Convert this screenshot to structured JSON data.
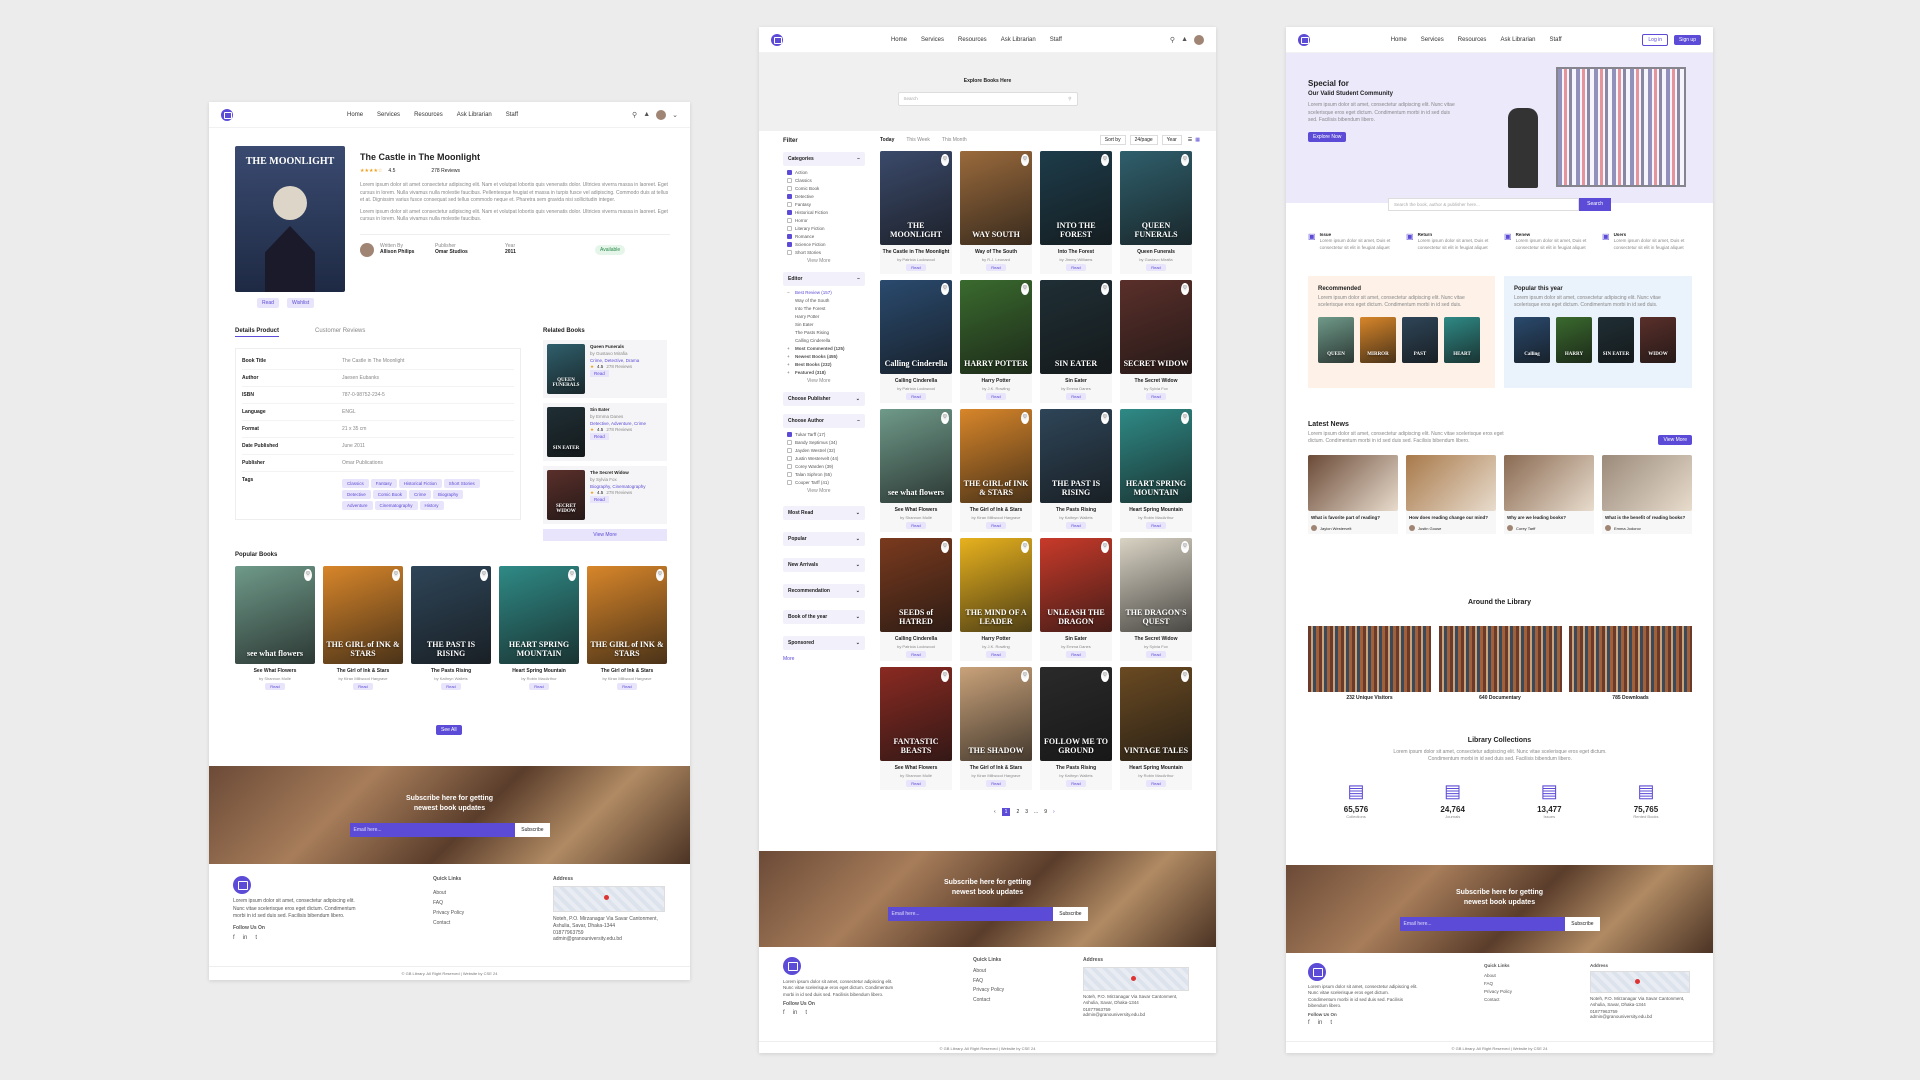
{
  "nav": {
    "links": [
      "Home",
      "Services",
      "Resources",
      "Ask Librarian",
      "Staff"
    ],
    "login": "Log in",
    "signup": "Sign up"
  },
  "detail": {
    "book_title": "The Castle in The Moonlight",
    "cover_title": "THE MOONLIGHT",
    "rating": "4.5",
    "reviews": "278 Reviews",
    "desc1": "Lorem ipsum dolor sit amet consectetur adipiscing elit. Nam et volutpat lobortis quis venenatis dolor. Ultricies viverra massa in laoreet. Eget cursus in lorem. Nulla vivamus nulla molestie faucibus. Pellentesque feugiat et massa in turpis fusce vel adipiscing. Commodo duis at tellus et at. Dignissim varius fusce consequat sed tellus commodo neque et. Pharetra sem gravida nisi sollicitudin integer.",
    "desc2": "Lorem ipsum dolor sit amet consectetur adipiscing elit. Nam et volutpat lobortis quis venenatis dolor. Ultricies viverra massa in laoreet. Eget cursus in lorem. Nulla vivamus nulla molestie faucibus.",
    "written_by_label": "Written By",
    "author": "Allison Philips",
    "publisher_label": "Publisher",
    "publisher": "Omar Studios",
    "year_label": "Year",
    "year": "2011",
    "status": "Available",
    "read_btn": "Read",
    "wishlist_btn": "Wishlist",
    "tab_active": "Details Product",
    "tab_inactive": "Customer Reviews",
    "details": [
      {
        "k": "Book Title",
        "v": "The Castle in The Moonlight"
      },
      {
        "k": "Author",
        "v": "Jaesen Eubanks"
      },
      {
        "k": "ISBN",
        "v": "787-0-98752-234-5"
      },
      {
        "k": "Language",
        "v": "ENGL"
      },
      {
        "k": "Format",
        "v": "21 x 35 cm"
      },
      {
        "k": "Date Published",
        "v": "June 2011"
      },
      {
        "k": "Publisher",
        "v": "Omar Publications"
      }
    ],
    "tags_label": "Tags",
    "tags": [
      "Classics",
      "Fantasy",
      "Historical Fiction",
      "Short Stories",
      "Detective",
      "Comic Book",
      "Crime",
      "Biography",
      "Adventure",
      "Cinematography",
      "History"
    ],
    "related_title": "Related Books",
    "related": [
      {
        "title": "Queen Funerals",
        "by": "by Gustavo Mirafia",
        "genres": "Crime, Detective, Drama",
        "rating": "4.5",
        "reviews": "278 Reviews",
        "btn": "Read",
        "cover": "QUEEN FUNERALS",
        "color": "#2f5f6c"
      },
      {
        "title": "Sin Eater",
        "by": "by Emma Danes",
        "genres": "Detective, Adventure, Crime",
        "rating": "4.5",
        "reviews": "278 Reviews",
        "btn": "Read",
        "cover": "SIN EATER",
        "color": "#1f2f35"
      },
      {
        "title": "The Secret Widow",
        "by": "by Sylvia Fox",
        "genres": "Biography, Cinematography",
        "rating": "4.5",
        "reviews": "278 Reviews",
        "btn": "Read",
        "cover": "SECRET WIDOW",
        "color": "#5a2f2a"
      }
    ],
    "view_more": "View More",
    "popular_title": "Popular Books",
    "popular": [
      {
        "title": "See What Flowers",
        "by": "by Shannon Mullé",
        "btn": "Read",
        "cover": "see what flowers",
        "color": "#6f9a8a"
      },
      {
        "title": "The Girl of Ink & Stars",
        "by": "by Kiran Millwood Hargrave",
        "btn": "Read",
        "cover": "THE GIRL of INK & STARS",
        "color": "#d8862a"
      },
      {
        "title": "The Pasts Rising",
        "by": "by Kathryn Wallets",
        "btn": "Read",
        "cover": "THE PAST IS RISING",
        "color": "#2e4558"
      },
      {
        "title": "Heart Spring Mountain",
        "by": "by Robin MacArthur",
        "btn": "Read",
        "cover": "HEART SPRING MOUNTAIN",
        "color": "#2f8a86"
      },
      {
        "title": "The Girl of Ink & Stars",
        "by": "by Kiran Millwood Hargrave",
        "btn": "Read",
        "cover": "THE GIRL of INK & STARS",
        "color": "#d8862a"
      }
    ],
    "see_all": "See All"
  },
  "subscribe": {
    "text": "Subscribe here for getting newest book updates",
    "email_placeholder": "Email here...",
    "button": "Subscribe"
  },
  "footer": {
    "about": "Lorem ipsum dolor sit amet, consectetur adipiscing elit. Nunc vitae scelerisque eros eget dictum. Condimentum morbi in id sed duis sed. Facilisis bibendum libero.",
    "follow": "Follow Us On",
    "quick_links_title": "Quick Links",
    "quick_links": [
      "About",
      "FAQ",
      "Privacy Policy",
      "Contact"
    ],
    "address_title": "Address",
    "address": "Noteh, P.O. Mirzanagar Via Savar Cantonment, Ashulia, Savar, Dhaka-1344",
    "phone": "01877963759",
    "email": "admin@granouniversity.edu.bd",
    "copyright": "© GB Library. All Right Reserved | Website by CSE 24"
  },
  "browse": {
    "hero_title": "Explore Books Here",
    "search_placeholder": "Search",
    "filter_title": "Filter",
    "time_tabs": [
      "Today",
      "This Week",
      "This Month"
    ],
    "sort_label": "Sort by",
    "view_label": "24/page",
    "rows_label": "Year",
    "categories_title": "Categories",
    "categories": [
      {
        "label": "Action",
        "on": true
      },
      {
        "label": "Classics",
        "on": false
      },
      {
        "label": "Comic Book",
        "on": false
      },
      {
        "label": "Detective",
        "on": true
      },
      {
        "label": "Fantasy",
        "on": false
      },
      {
        "label": "Historical Fiction",
        "on": true
      },
      {
        "label": "Horror",
        "on": false
      },
      {
        "label": "Literary Fiction",
        "on": false
      },
      {
        "label": "Romance",
        "on": true
      },
      {
        "label": "Science Fiction",
        "on": true
      },
      {
        "label": "Short Stories",
        "on": false
      }
    ],
    "editor_title": "Editor",
    "editor_items": [
      "Best Review (157)",
      "Way of the South",
      "Into The Forest",
      "Harry Potter",
      "Sin Eater",
      "The Pasts Rising",
      "Calling Cinderella",
      "Most Commented (125)",
      "Newest Books (455)",
      "Best Books (232)",
      "Featured (318)"
    ],
    "view_more": "View More",
    "publisher_title": "Choose Publisher",
    "author_title": "Choose Author",
    "authors": [
      {
        "label": "Tukar Tarff (17)",
        "on": true
      },
      {
        "label": "Bandy Septimus (34)",
        "on": false
      },
      {
        "label": "Jayden Westrel (32)",
        "on": false
      },
      {
        "label": "Justin Westervelt (44)",
        "on": false
      },
      {
        "label": "Corey Warden (39)",
        "on": false
      },
      {
        "label": "Talan Siphron (55)",
        "on": false
      },
      {
        "label": "Cooper Tarff (41)",
        "on": false
      }
    ],
    "more_sections": [
      "Most Read",
      "Popular",
      "New Arrivals",
      "Recommendation",
      "Book of the year",
      "Sponsored"
    ],
    "more": "More",
    "books": [
      {
        "title": "The Castle in The Moonlight",
        "by": "by Patricia Lockwood",
        "cover": "THE MOONLIGHT",
        "color": "#3b4a6b"
      },
      {
        "title": "Way of The South",
        "by": "by R.J. Leonard",
        "cover": "WAY SOUTH",
        "color": "#9a6a3c"
      },
      {
        "title": "Into The Forest",
        "by": "by Jimmy Williams",
        "cover": "INTO THE FOREST",
        "color": "#1d3c4a"
      },
      {
        "title": "Queen Funerals",
        "by": "by Gustavo Mirafia",
        "cover": "QUEEN FUNERALS",
        "color": "#2f5f6c"
      },
      {
        "title": "Calling Cinderella",
        "by": "by Patricia Lockwood",
        "cover": "Calling Cinderella",
        "color": "#2a4a6e"
      },
      {
        "title": "Harry Potter",
        "by": "by J.K. Rowling",
        "cover": "HARRY POTTER",
        "color": "#3a6a2e"
      },
      {
        "title": "Sin Eater",
        "by": "by Emma Danes",
        "cover": "SIN EATER",
        "color": "#1f2f35"
      },
      {
        "title": "The Secret Widow",
        "by": "by Sylvia Fox",
        "cover": "SECRET WIDOW",
        "color": "#5a2f2a"
      },
      {
        "title": "See What Flowers",
        "by": "by Shannon Mullé",
        "cover": "see what flowers",
        "color": "#6f9a8a"
      },
      {
        "title": "The Girl of Ink & Stars",
        "by": "by Kiran Millwood Hargrave",
        "cover": "THE GIRL of INK & STARS",
        "color": "#d8862a"
      },
      {
        "title": "The Pasts Rising",
        "by": "by Kathryn Wallets",
        "cover": "THE PAST IS RISING",
        "color": "#2e4558"
      },
      {
        "title": "Heart Spring Mountain",
        "by": "by Robin MacArthur",
        "cover": "HEART SPRING MOUNTAIN",
        "color": "#2f8a86"
      },
      {
        "title": "Calling Cinderella",
        "by": "by Patricia Lockwood",
        "cover": "SEEDS of HATRED",
        "color": "#7a3a1e"
      },
      {
        "title": "Harry Potter",
        "by": "by J.K. Rowling",
        "cover": "THE MIND OF A LEADER",
        "color": "#e8b21e"
      },
      {
        "title": "Sin Eater",
        "by": "by Emma Danes",
        "cover": "UNLEASH THE DRAGON",
        "color": "#c83a2a"
      },
      {
        "title": "The Secret Widow",
        "by": "by Sylvia Fox",
        "cover": "THE DRAGON'S QUEST",
        "color": "#d9d3c4"
      },
      {
        "title": "See What Flowers",
        "by": "by Shannon Mullé",
        "cover": "FANTASTIC BEASTS",
        "color": "#8a2a22"
      },
      {
        "title": "The Girl of Ink & Stars",
        "by": "by Kiran Millwood Hargrave",
        "cover": "THE SHADOW",
        "color": "#c9a27a"
      },
      {
        "title": "The Pasts Rising",
        "by": "by Kathryn Wallets",
        "cover": "FOLLOW ME TO GROUND",
        "color": "#2a2a2a"
      },
      {
        "title": "Heart Spring Mountain",
        "by": "by Robin MacArthur",
        "cover": "VINTAGE TALES",
        "color": "#6a4a22"
      }
    ],
    "read_btn": "Read",
    "pages": [
      "1",
      "2",
      "3",
      "...",
      "9"
    ]
  },
  "home": {
    "hero_title": "Special for",
    "hero_sub": "Our Valid Student Community",
    "hero_desc": "Lorem ipsum dolor sit amet, consectetur adipiscing elit. Nunc vitae scelerisque eros eget dictum. Condimentum morbi in id sed duis sed. Facilisis bibendum libero.",
    "explore_btn": "Explore Now",
    "search_placeholder": "Search the book, author & publisher here...",
    "search_btn": "Search",
    "features": [
      {
        "title": "Issue",
        "desc": "Lorem ipsum dolor sit amet, Duis et consectetur sit elit in feugiat aliquet"
      },
      {
        "title": "Return",
        "desc": "Lorem ipsum dolor sit amet, Duis et consectetur sit elit in feugiat aliquet"
      },
      {
        "title": "Renew",
        "desc": "Lorem ipsum dolor sit amet, Duis et consectetur sit elit in feugiat aliquet"
      },
      {
        "title": "Users",
        "desc": "Lorem ipsum dolor sit amet, Duis et consectetur sit elit in feugiat aliquet"
      }
    ],
    "recommended_title": "Recommended",
    "recommended_desc": "Lorem ipsum dolor sit amet, consectetur adipiscing elit. Nunc vitae scelerisque eros eget dictum. Condimentum morbi in id sed duis.",
    "popular_title": "Popular this year",
    "popular_desc": "Lorem ipsum dolor sit amet, consectetur adipiscing elit. Nunc vitae scelerisque eros eget dictum. Condimentum morbi in id sed duis.",
    "recommended_covers": [
      {
        "c": "QUEEN",
        "color": "#6f9a8a"
      },
      {
        "c": "MIRROR",
        "color": "#d8862a"
      },
      {
        "c": "PAST",
        "color": "#2e4558"
      },
      {
        "c": "HEART",
        "color": "#2f8a86"
      }
    ],
    "popular_covers": [
      {
        "c": "Calling",
        "color": "#2a4a6e"
      },
      {
        "c": "HARRY",
        "color": "#3a6a2e"
      },
      {
        "c": "SIN EATER",
        "color": "#1f2f35"
      },
      {
        "c": "WIDOW",
        "color": "#5a2f2a"
      }
    ],
    "news_title": "Latest News",
    "news_desc": "Lorem ipsum dolor sit amet, consectetur adipiscing elit. Nunc vitae scelerisque eros eget dictum. Condimentum morbi in id sed duis sed. Facilisis bibendum libero.",
    "news_btn": "View More",
    "news": [
      {
        "title": "What is favorite part of reading?",
        "author": "Jaylon Westervelt"
      },
      {
        "title": "How does reading change our mind?",
        "author": "Justin Gouse"
      },
      {
        "title": "Why are we leading books?",
        "author": "Corey Tarff"
      },
      {
        "title": "What is the benefit of reading books?",
        "author": "Emma Jodorov"
      }
    ],
    "around_title": "Around the Library",
    "around": [
      "232 Unique Visitors",
      "640 Documentary",
      "785 Downloads"
    ],
    "collections_title": "Library Collections",
    "collections_desc": "Lorem ipsum dolor sit amet, consectetur adipiscing elit. Nunc vitae scelerisque eros eget dictum. Condimentum morbi in id sed duis sed. Facilisis bibendum libero.",
    "collections": [
      {
        "value": "65,576",
        "label": "Collections"
      },
      {
        "value": "24,764",
        "label": "Journals"
      },
      {
        "value": "13,477",
        "label": "Issues"
      },
      {
        "value": "75,765",
        "label": "Rented Books"
      }
    ]
  }
}
